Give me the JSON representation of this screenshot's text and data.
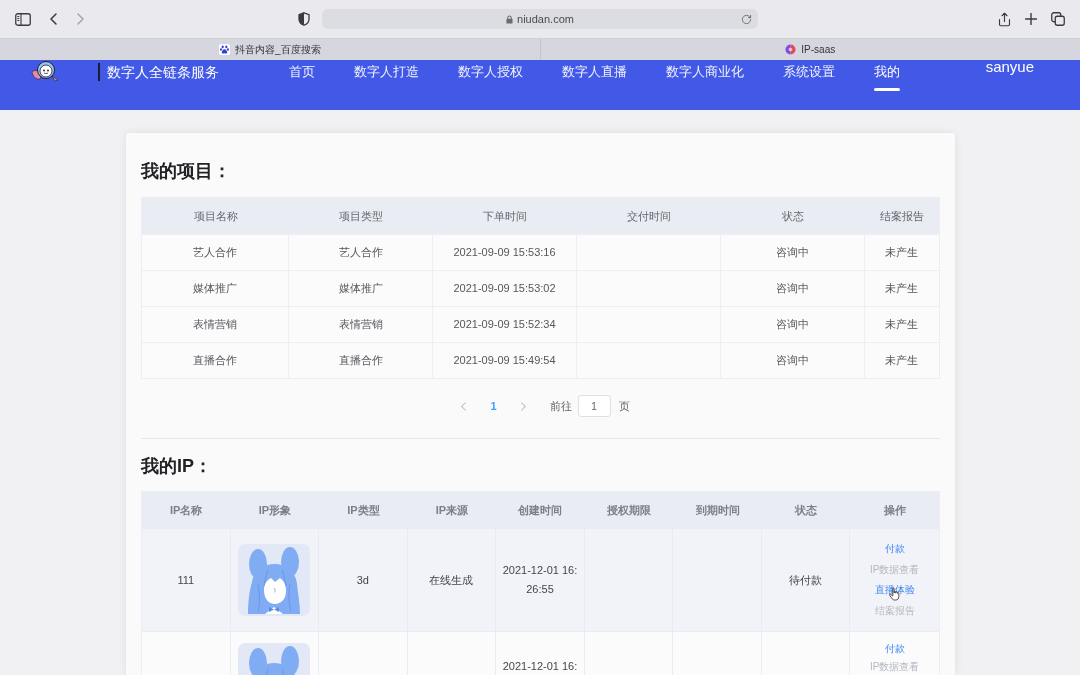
{
  "browser": {
    "address": "niudan.com",
    "tabs": [
      {
        "title": "抖音内容_百度搜索"
      },
      {
        "title": "IP-saas"
      }
    ]
  },
  "header": {
    "brand": "数字人全链条服务",
    "nav": [
      {
        "label": "首页",
        "selected": false
      },
      {
        "label": "数字人打造",
        "selected": false
      },
      {
        "label": "数字人授权",
        "selected": false
      },
      {
        "label": "数字人直播",
        "selected": false
      },
      {
        "label": "数字人商业化",
        "selected": false
      },
      {
        "label": "系统设置",
        "selected": false
      },
      {
        "label": "我的",
        "selected": true
      }
    ],
    "user": "sanyue"
  },
  "projects": {
    "title": "我的项目：",
    "columns": [
      "项目名称",
      "项目类型",
      "下单时间",
      "交付时间",
      "状态",
      "结案报告"
    ],
    "rows": [
      {
        "name": "艺人合作",
        "type": "艺人合作",
        "ordered_at": "2021-09-09 15:53:16",
        "status": "咨询中",
        "report": "未产生"
      },
      {
        "name": "媒体推广",
        "type": "媒体推广",
        "ordered_at": "2021-09-09 15:53:02",
        "status": "咨询中",
        "report": "未产生"
      },
      {
        "name": "表情营销",
        "type": "表情营销",
        "ordered_at": "2021-09-09 15:52:34",
        "status": "咨询中",
        "report": "未产生"
      },
      {
        "name": "直播合作",
        "type": "直播合作",
        "ordered_at": "2021-09-09 15:49:54",
        "status": "咨询中",
        "report": "未产生"
      }
    ],
    "pagination": {
      "pages": [
        {
          "label": "1",
          "selected": true
        }
      ],
      "goto_label": "前往",
      "goto_value": "1",
      "unit": "页"
    }
  },
  "ips": {
    "title": "我的IP：",
    "columns": [
      "IP名称",
      "IP形象",
      "IP类型",
      "IP来源",
      "创建时间",
      "授权期限",
      "到期时间",
      "状态",
      "操作"
    ],
    "rows": [
      {
        "name": "111",
        "type": "3d",
        "source": "在线生成",
        "created_at": "2021-12-01 16:26:55",
        "status": "待付款",
        "hovered": true,
        "actions": [
          {
            "label": "付款",
            "disabled": false
          },
          {
            "label": "IP数据查看",
            "disabled": true
          },
          {
            "label": "直播体验",
            "disabled": false
          },
          {
            "label": "结案报告",
            "disabled": true
          }
        ]
      },
      {
        "created_at": "2021-12-01 16:",
        "hovered": false,
        "actions": [
          {
            "label": "付款",
            "disabled": false
          },
          {
            "label": "IP数据查看",
            "disabled": true
          }
        ]
      }
    ]
  }
}
